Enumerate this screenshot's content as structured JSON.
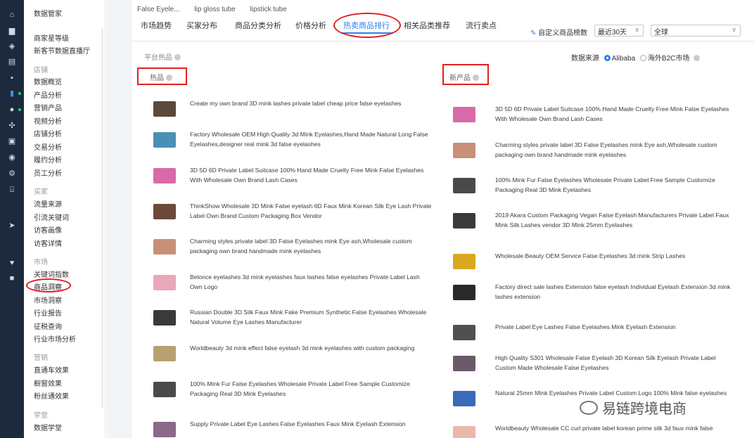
{
  "sidebar": {
    "items": [
      {
        "label": "数据管家",
        "type": "item"
      },
      {
        "label": "商家星等级",
        "type": "item"
      },
      {
        "label": "新客节数据直播厅",
        "type": "item"
      },
      {
        "label": "店铺",
        "type": "header"
      },
      {
        "label": "数据概览",
        "type": "item"
      },
      {
        "label": "产品分析",
        "type": "item"
      },
      {
        "label": "营销产品",
        "type": "item"
      },
      {
        "label": "视频分析",
        "type": "item"
      },
      {
        "label": "店铺分析",
        "type": "item"
      },
      {
        "label": "交易分析",
        "type": "item"
      },
      {
        "label": "履约分析",
        "type": "item"
      },
      {
        "label": "员工分析",
        "type": "item"
      },
      {
        "label": "买家",
        "type": "header"
      },
      {
        "label": "流量来源",
        "type": "item"
      },
      {
        "label": "引流关键词",
        "type": "item"
      },
      {
        "label": "访客画像",
        "type": "item"
      },
      {
        "label": "访客详情",
        "type": "item"
      },
      {
        "label": "市场",
        "type": "header"
      },
      {
        "label": "关键词指数",
        "type": "item"
      },
      {
        "label": "商品洞察",
        "type": "item",
        "selected": true
      },
      {
        "label": "市场洞察",
        "type": "item"
      },
      {
        "label": "行业报告",
        "type": "item"
      },
      {
        "label": "征税查询",
        "type": "item"
      },
      {
        "label": "行业市场分析",
        "type": "item"
      },
      {
        "label": "营销",
        "type": "header"
      },
      {
        "label": "直通车效果",
        "type": "item"
      },
      {
        "label": "橱窗效果",
        "type": "item"
      },
      {
        "label": "粉丝通效果",
        "type": "item"
      },
      {
        "label": "学堂",
        "type": "header"
      },
      {
        "label": "数据学堂",
        "type": "item"
      }
    ],
    "rail_icons": [
      "home-icon",
      "store-icon",
      "shield-icon",
      "document-icon",
      "message-icon",
      "chart-icon",
      "users-icon",
      "share-icon",
      "clipboard-icon",
      "globe-icon",
      "settings-icon",
      "bank-icon",
      "send-icon",
      "heart-icon",
      "briefcase-icon"
    ]
  },
  "keyword_tabs": [
    "False Eyele...",
    "lip gloss tube",
    "lipstick tube"
  ],
  "tabs": [
    "市场趋势",
    "买家分布",
    "商品分类分析",
    "价格分析",
    "热卖商品排行",
    "相关品类推荐",
    "流行卖点"
  ],
  "active_tab_index": 4,
  "toolbar": {
    "custom_label": "自定义商品榜数",
    "period_value": "最近30天",
    "region_value": "全球"
  },
  "platform_label": "平台热品",
  "data_source": {
    "label": "数据来源",
    "options": [
      "Alibaba",
      "海外B2C市场"
    ],
    "selected_index": 0
  },
  "columns": {
    "left_title": "热品",
    "right_title": "新产品"
  },
  "hot_products": [
    "Create my own brand 3D mink lashes private label cheap price false eyelashes",
    "Factory Wholesale OEM High Quality 3d Mink Eyelashes,Hand Made Natural Long False Eyelashes,designer real mink 3d false eyelashes",
    "3D 5D 6D Private Label Suitcase 100% Hand Made Cruelty Free Mink False Eyelashes With Wholesale Own Brand Lash Cases",
    "ThinkShow Wholesale 3D Mink False eyelash 6D Faux Mink Korean Silk Eye Lash Private Label Own Brand Custom Packaging Box Vendor",
    "Charming styles private label 3D False Eyelashes mink Eye ash,Wholesale custom packaging own brand handmade mink eyelashes",
    "Belonce eyelashes 3d mink eyelashes faux lashes false eyelashes Private Label Lash Own Logo",
    "Russian Double 3D Silk Faux Mink Fake Premium Synthetic False Eyelashes Wholesale Natural Volume Eye Lashes Manufacturer",
    "Worldbeauty 3d mink effect false eyelash 3d mink eyelashes with custom packaging",
    "100% Mink Fur False Eyelashes Wholesale Private Label Free Sample Customize Packaging Real 3D Mink Eyelashes",
    "Supply Private Label Eye Lashes False Eyelashes Faux Mink Eyelash Extension"
  ],
  "new_products": [
    "3D 5D 6D Private Label Suitcase 100% Hand Made Cruelty Free Mink False Eyelashes With Wholesale Own Brand Lash Cases",
    "Charming styles private label 3D False Eyelashes mink Eye ash,Wholesale custom packaging own brand handmade mink eyelashes",
    "100% Mink Fur False Eyelashes Wholesale Private Label Free Sample Customize Packaging Real 3D Mink Eyelashes",
    "2019 Akara Custom Packaging Vegan False Eyelash Manufacturers Private Label Faux Mink Silk Lashes vendor 3D Mink 25mm Eyelashes",
    "Wholesale Beauty OEM Service False Eyelashes 3d mink Strip Lashes",
    "Factory direct sale lashes Extension false eyelash Individual Eyelash Extension 3d mink lashes extension",
    "Private Label Eye Lashes False Eyelashes Mink Eyelash Extension",
    "High Quality S301 Wholesale False Eyelash 3D Korean Silk Eyelash Private Label Custom Made Wholesale False Eyelashes",
    "Natural 25mm Mink Eyelashes Private Label Custom Logo 100% Mink false eyelashes",
    "Worldbeauty Wholesale CC curl private label korean prime silk 3d faux mink false"
  ],
  "watermark": "易链跨境电商",
  "colors": {
    "rail_bg": "#1d2a3e",
    "accent": "#2f80ed",
    "annotation_red": "#e02020"
  }
}
